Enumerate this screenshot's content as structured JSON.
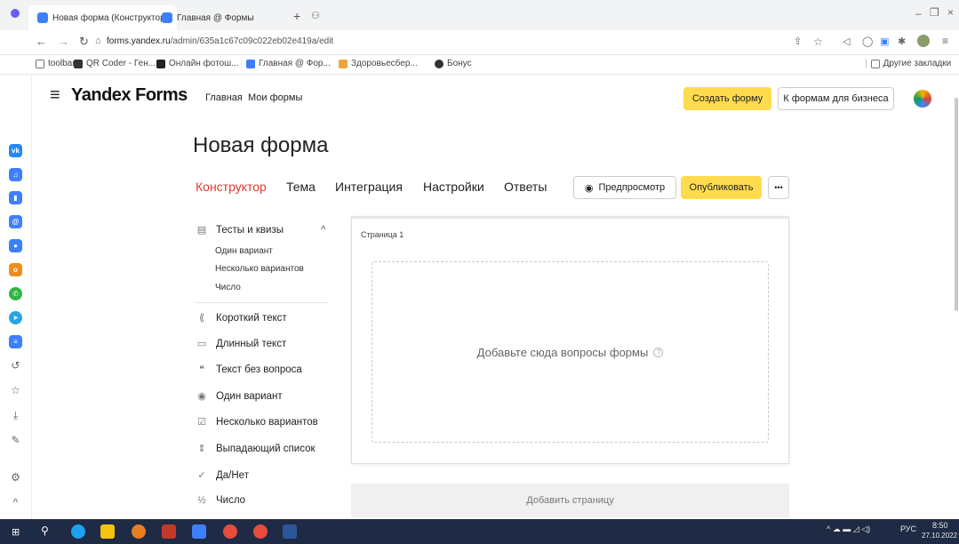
{
  "browser": {
    "tabs": [
      {
        "label": "Новая форма (Конструктор)"
      },
      {
        "label": "Главная @ Формы"
      }
    ],
    "new_tab_glyph": "+",
    "url_host": "forms.yandex.ru",
    "url_path": "/admin/635a1c67c09c022eb02e419a/edit",
    "bookmarks": [
      {
        "label": "toolbar"
      },
      {
        "label": "QR Coder - Ген..."
      },
      {
        "label": "Онлайн фотош..."
      },
      {
        "label": "Главная @ Фор..."
      },
      {
        "label": "Здоровьесбер..."
      },
      {
        "label": "Бонус"
      }
    ],
    "other_bookmarks": "Другие закладки"
  },
  "header": {
    "brand": "Yandex Forms",
    "nav": [
      "Главная",
      "Мои формы"
    ],
    "create_button": "Создать форму",
    "business_button": "К формам для бизнеса"
  },
  "page": {
    "title": "Новая форма",
    "tabs": [
      "Конструктор",
      "Тема",
      "Интеграция",
      "Настройки",
      "Ответы"
    ],
    "preview_button": "Предпросмотр",
    "publish_button": "Опубликовать",
    "more_button": "•••"
  },
  "sidebar": {
    "group_label": "Тесты и квизы",
    "group_items": [
      "Один вариант",
      "Несколько вариантов",
      "Число"
    ],
    "items": [
      {
        "label": "Короткий текст",
        "icon": "short-text-icon"
      },
      {
        "label": "Длинный текст",
        "icon": "long-text-icon"
      },
      {
        "label": "Текст без вопроса",
        "icon": "quote-icon"
      },
      {
        "label": "Один вариант",
        "icon": "radio-icon"
      },
      {
        "label": "Несколько вариантов",
        "icon": "checkbox-icon"
      },
      {
        "label": "Выпадающий список",
        "icon": "dropdown-icon"
      },
      {
        "label": "Да/Нет",
        "icon": "check-icon"
      },
      {
        "label": "Число",
        "icon": "number-icon"
      }
    ]
  },
  "editor": {
    "page_label": "Страница 1",
    "dropzone_text": "Добавьте сюда вопросы формы",
    "help_glyph": "?",
    "add_page": "Добавить страницу"
  },
  "taskbar": {
    "lang": "РУС",
    "time": "8:50",
    "date": "27.10.2022"
  },
  "colors": {
    "accent_red": "#e03a2f",
    "accent_yellow": "#ffdb4d"
  }
}
